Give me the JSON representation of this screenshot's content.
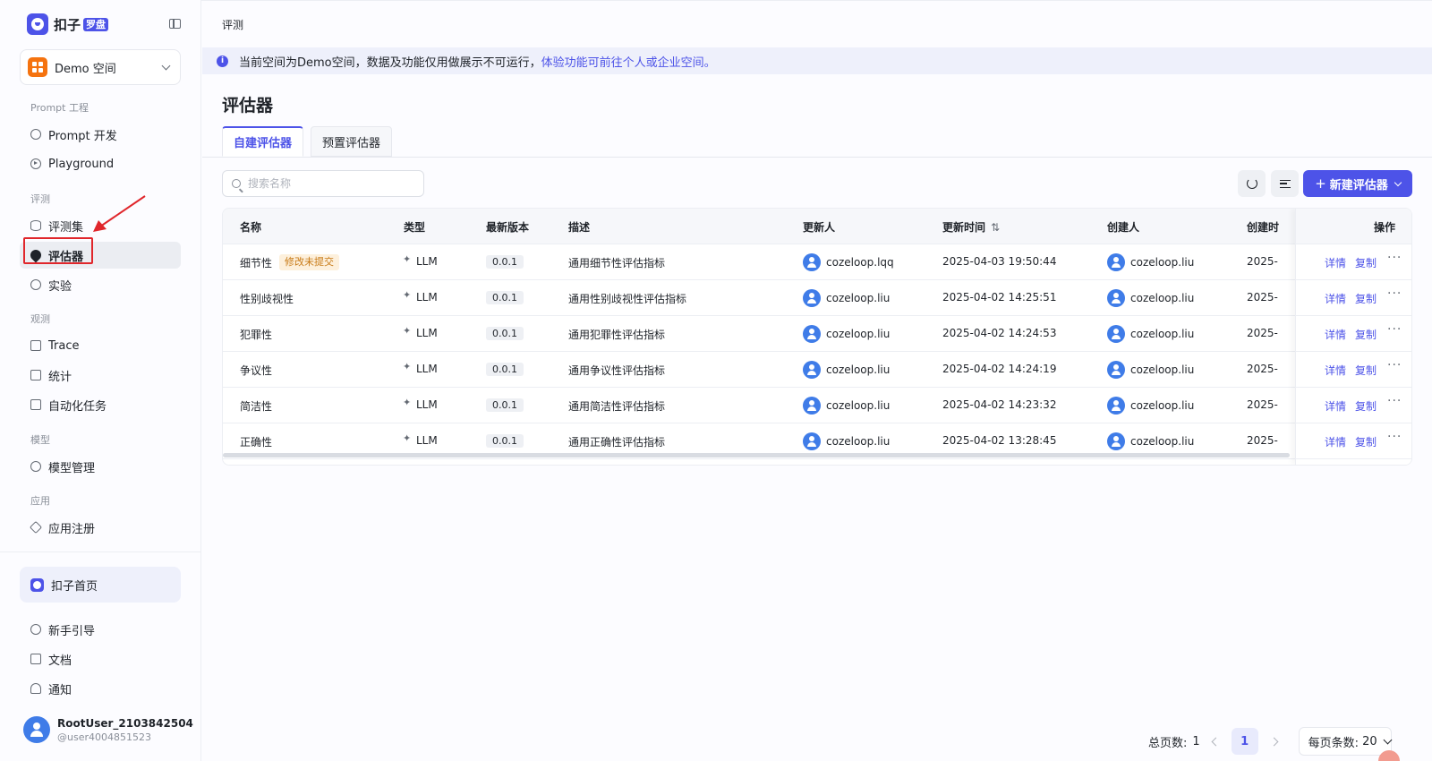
{
  "brand": {
    "name": "扣子",
    "tag": "罗盘"
  },
  "space": {
    "label": "Demo 空间"
  },
  "sidebar": {
    "sections": [
      {
        "title": "Prompt 工程",
        "items": [
          {
            "label": "Prompt 开发"
          },
          {
            "label": "Playground"
          }
        ]
      },
      {
        "title": "评测",
        "items": [
          {
            "label": "评测集"
          },
          {
            "label": "评估器"
          },
          {
            "label": "实验"
          }
        ]
      },
      {
        "title": "观测",
        "items": [
          {
            "label": "Trace"
          },
          {
            "label": "统计"
          },
          {
            "label": "自动化任务"
          }
        ]
      },
      {
        "title": "模型",
        "items": [
          {
            "label": "模型管理"
          }
        ]
      },
      {
        "title": "应用",
        "items": [
          {
            "label": "应用注册"
          }
        ]
      }
    ],
    "home": "扣子首页",
    "footer_items": [
      {
        "label": "新手引导"
      },
      {
        "label": "文档"
      },
      {
        "label": "通知"
      }
    ],
    "user": {
      "name": "RootUser_2103842504",
      "handle": "@user4004851523"
    }
  },
  "breadcrumb": "评测",
  "notice": {
    "text": "当前空间为Demo空间，数据及功能仅用做展示不可运行，",
    "link": "体验功能可前往个人或企业空间。"
  },
  "page_title": "评估器",
  "tabs": [
    {
      "label": "自建评估器"
    },
    {
      "label": "预置评估器"
    }
  ],
  "search": {
    "placeholder": "搜索名称",
    "value": ""
  },
  "toolbar": {
    "new_label": "新建评估器",
    "plus": "+"
  },
  "table": {
    "columns": {
      "name": "名称",
      "type": "类型",
      "version": "最新版本",
      "desc": "描述",
      "updater": "更新人",
      "updated_at": "更新时间",
      "sort": "⇅",
      "creator": "创建人",
      "created_at": "创建时",
      "ops": "操作"
    },
    "ops_labels": {
      "detail": "详情",
      "copy": "复制",
      "more": "···"
    },
    "rows": [
      {
        "name": "细节性",
        "badge": "修改未提交",
        "type": "LLM",
        "version": "0.0.1",
        "desc": "通用细节性评估指标",
        "updater": "cozeloop.lqq",
        "updated_at": "2025-04-03 19:50:44",
        "creator": "cozeloop.liu",
        "created_at": "2025-"
      },
      {
        "name": "性别歧视性",
        "badge": "",
        "type": "LLM",
        "version": "0.0.1",
        "desc": "通用性别歧视性评估指标",
        "updater": "cozeloop.liu",
        "updated_at": "2025-04-02 14:25:51",
        "creator": "cozeloop.liu",
        "created_at": "2025-"
      },
      {
        "name": "犯罪性",
        "badge": "",
        "type": "LLM",
        "version": "0.0.1",
        "desc": "通用犯罪性评估指标",
        "updater": "cozeloop.liu",
        "updated_at": "2025-04-02 14:24:53",
        "creator": "cozeloop.liu",
        "created_at": "2025-"
      },
      {
        "name": "争议性",
        "badge": "",
        "type": "LLM",
        "version": "0.0.1",
        "desc": "通用争议性评估指标",
        "updater": "cozeloop.liu",
        "updated_at": "2025-04-02 14:24:19",
        "creator": "cozeloop.liu",
        "created_at": "2025-"
      },
      {
        "name": "简洁性",
        "badge": "",
        "type": "LLM",
        "version": "0.0.1",
        "desc": "通用简洁性评估指标",
        "updater": "cozeloop.liu",
        "updated_at": "2025-04-02 14:23:32",
        "creator": "cozeloop.liu",
        "created_at": "2025-"
      },
      {
        "name": "正确性",
        "badge": "",
        "type": "LLM",
        "version": "0.0.1",
        "desc": "通用正确性评估指标",
        "updater": "cozeloop.liu",
        "updated_at": "2025-04-02 13:28:45",
        "creator": "cozeloop.liu",
        "created_at": "2025-"
      }
    ]
  },
  "pagination": {
    "total_label": "总页数:",
    "total": "1",
    "current": "1",
    "page_size_label": "每页条数:",
    "page_size": "20"
  },
  "colors": {
    "accent": "#4d53e8",
    "highlight_box": "#e0262b",
    "warn_badge": "#c87a16"
  }
}
